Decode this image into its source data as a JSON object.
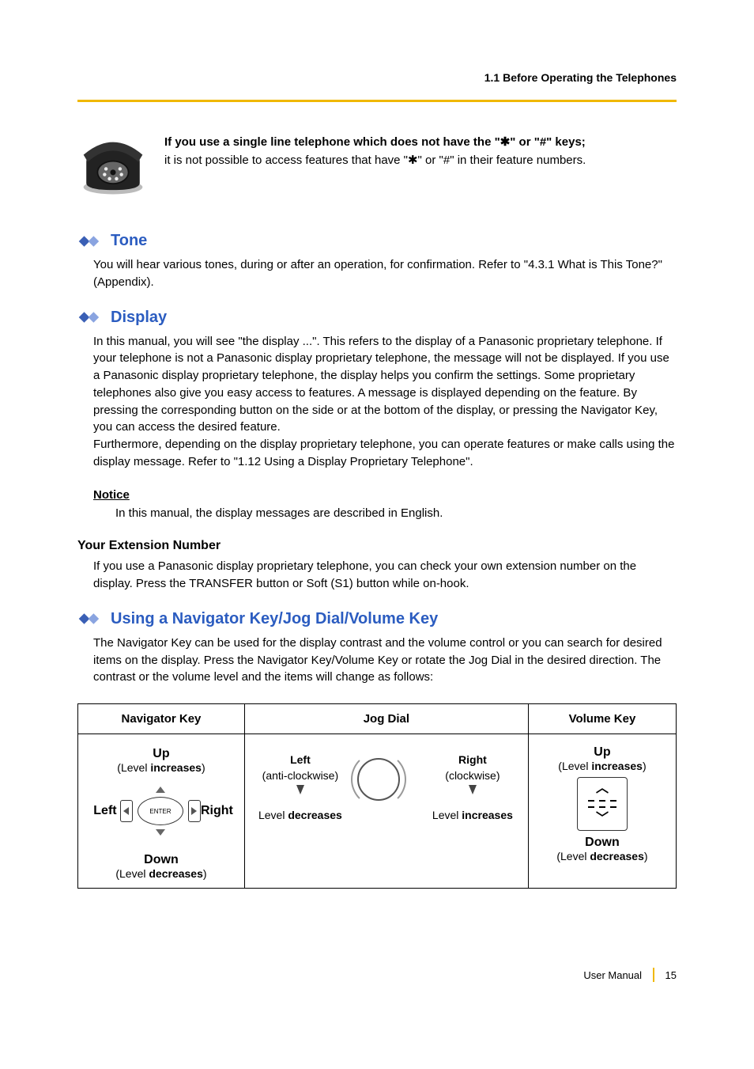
{
  "header": {
    "running": "1.1 Before Operating the Telephones"
  },
  "intro": {
    "bold": "If you use a single line telephone which does not have the \"✱\" or \"#\" keys;",
    "plain": "it is not possible to access features that have \"✱\" or \"#\" in their feature numbers."
  },
  "tone": {
    "title": "Tone",
    "body": "You will hear various tones, during or after an operation, for confirmation. Refer to \"4.3.1 What is This Tone?\" (Appendix)."
  },
  "display": {
    "title": "Display",
    "body": "In this manual, you will see \"the display ...\". This refers to the display of a Panasonic proprietary telephone. If your telephone is not a Panasonic display proprietary telephone, the message will not be displayed. If you use a Panasonic display proprietary telephone, the display helps you confirm the settings. Some proprietary telephones also give you easy access to features. A message is displayed depending on the feature. By pressing the corresponding button on the side or at the bottom of the display, or pressing the Navigator Key, you can access the desired feature.\nFurthermore, depending on the display proprietary telephone, you can operate features or make calls using the display message. Refer to \"1.12 Using a Display Proprietary Telephone\".",
    "notice_label": "Notice",
    "notice_body": "In this manual, the display messages are described in English.",
    "ext_head": "Your Extension Number",
    "ext_body": "If you use a Panasonic display proprietary telephone, you can check your own extension number on the display. Press the TRANSFER button or Soft (S1) button while on-hook."
  },
  "navkey": {
    "title": "Using a Navigator Key/Jog Dial/Volume Key",
    "body": "The Navigator Key can be used for the display contrast and the volume control or you can search for desired items on the display. Press the Navigator Key/Volume Key or rotate the Jog Dial in the desired direction. The contrast or the volume level and the items will change as follows:"
  },
  "table": {
    "headers": [
      "Navigator Key",
      "Jog Dial",
      "Volume Key"
    ],
    "nav": {
      "up": "Up",
      "up_sub_pre": "(Level ",
      "up_sub_bold": "increases",
      "up_sub_post": ")",
      "left": "Left",
      "right": "Right",
      "enter": "ENTER",
      "down": "Down",
      "down_sub_pre": "(Level ",
      "down_sub_bold": "decreases",
      "down_sub_post": ")"
    },
    "jog": {
      "left": "Left",
      "left_sub": "(anti-clockwise)",
      "right": "Right",
      "right_sub": "(clockwise)",
      "left_level_pre": "Level ",
      "left_level_bold": "decreases",
      "right_level_pre": "Level ",
      "right_level_bold": "increases"
    },
    "vol": {
      "up": "Up",
      "up_sub_pre": "(Level ",
      "up_sub_bold": "increases",
      "up_sub_post": ")",
      "down": "Down",
      "down_sub_pre": "(Level ",
      "down_sub_bold": "decreases",
      "down_sub_post": ")"
    }
  },
  "footer": {
    "label": "User Manual",
    "page": "15"
  }
}
